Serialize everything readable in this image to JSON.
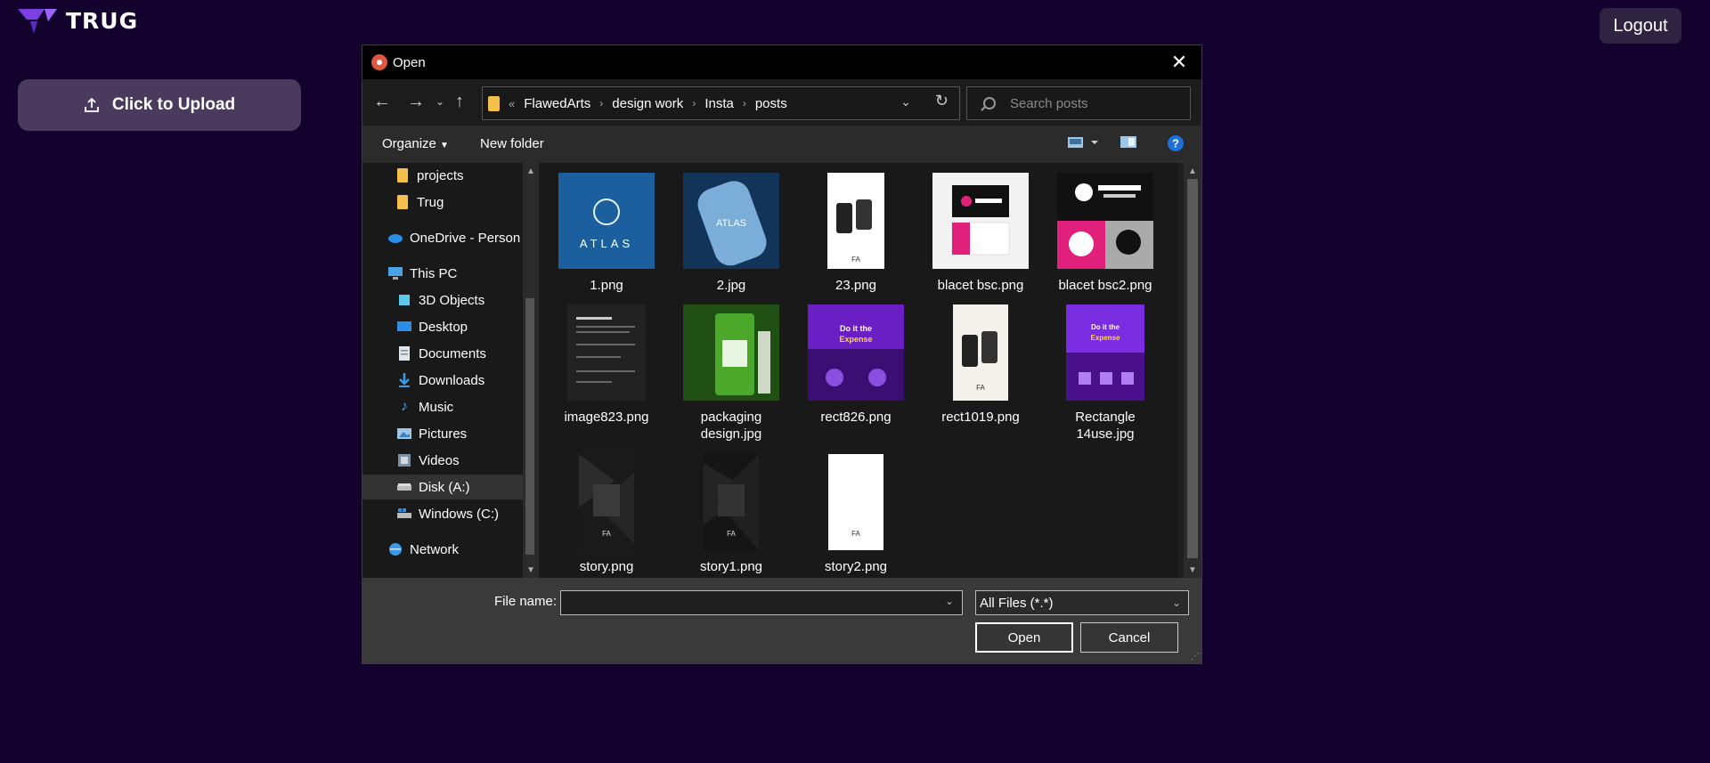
{
  "app": {
    "brand": "TRUG",
    "logout_label": "Logout",
    "upload_label": "Click to Upload"
  },
  "dialog": {
    "title": "Open",
    "breadcrumb": [
      "FlawedArts",
      "design work",
      "Insta",
      "posts"
    ],
    "search_placeholder": "Search posts",
    "toolbar": {
      "organize": "Organize",
      "new_folder": "New folder"
    },
    "nav": {
      "projects": "projects",
      "trug": "Trug",
      "onedrive": "OneDrive - Person",
      "thispc": "This PC",
      "objects3d": "3D Objects",
      "desktop": "Desktop",
      "documents": "Documents",
      "downloads": "Downloads",
      "music": "Music",
      "pictures": "Pictures",
      "videos": "Videos",
      "disk_a": "Disk  (A:)",
      "windows_c": "Windows (C:)",
      "network": "Network"
    },
    "files": {
      "f1": "1.png",
      "f2": "2.jpg",
      "f3": "23.png",
      "f4": "blacet bsc.png",
      "f5": "blacet bsc2.png",
      "f6": "image823.png",
      "f7": "packaging design.jpg",
      "f8": "rect826.png",
      "f9": "rect1019.png",
      "f10": "Rectangle 14use.jpg",
      "f11": "story.png",
      "f12": "story1.png",
      "f13": "story2.png"
    },
    "filename_label": "File name:",
    "filename_value": "",
    "filter_value": "All Files (*.*)",
    "open_label": "Open",
    "cancel_label": "Cancel"
  }
}
